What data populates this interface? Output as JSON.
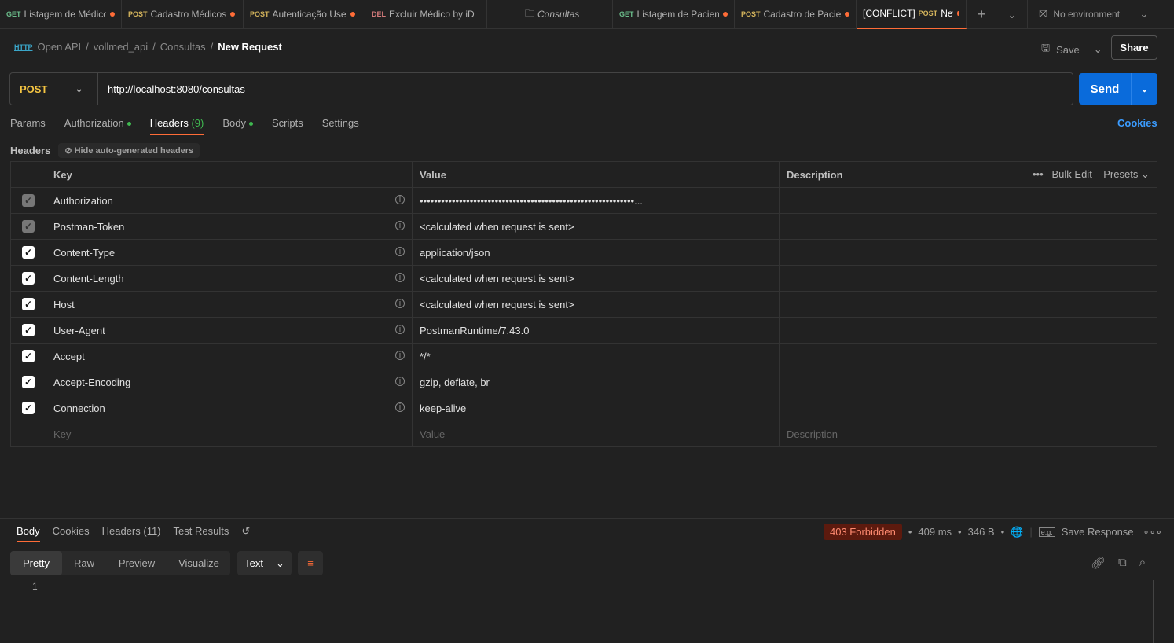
{
  "tabs": [
    {
      "method": "GET",
      "label": "Listagem de Médicc",
      "dirty": true
    },
    {
      "method": "POST",
      "label": "Cadastro Médicos",
      "dirty": true
    },
    {
      "method": "POST",
      "label": "Autenticação Use",
      "dirty": true
    },
    {
      "method": "DEL",
      "label": "Excluir Médico by iD",
      "dirty": false
    },
    {
      "method": "",
      "label": "Consultas",
      "dirty": false
    },
    {
      "method": "GET",
      "label": "Listagem de Pacient",
      "dirty": true
    },
    {
      "method": "POST",
      "label": "Cadastro de Pacier",
      "dirty": true
    },
    {
      "prefix": "[CONFLICT]",
      "method": "POST",
      "label": "New R",
      "dirty": true
    }
  ],
  "environment": "No environment",
  "breadcrumb": [
    "Open API",
    "vollmed_api",
    "Consultas",
    "New Request"
  ],
  "save_label": "Save",
  "share_label": "Share",
  "request": {
    "method": "POST",
    "url": "http://localhost:8080/consultas",
    "send_label": "Send"
  },
  "request_tabs": {
    "params": "Params",
    "authorization": "Authorization",
    "headers": "Headers",
    "headers_count": "(9)",
    "body": "Body",
    "scripts": "Scripts",
    "settings": "Settings",
    "cookies": "Cookies"
  },
  "headers_section": {
    "label": "Headers",
    "hide_auto": "Hide auto-generated headers"
  },
  "table": {
    "columns": [
      "Key",
      "Value",
      "Description"
    ],
    "bulk_edit": "Bulk Edit",
    "presets": "Presets",
    "rows": [
      {
        "key": "Authorization",
        "value": "••••••••••••••••••••••••••••••••••••••••••••••••••••••••••••...",
        "checked": true,
        "disabled": true
      },
      {
        "key": "Postman-Token",
        "value": "<calculated when request is sent>",
        "checked": true,
        "disabled": true
      },
      {
        "key": "Content-Type",
        "value": "application/json",
        "checked": true,
        "disabled": false
      },
      {
        "key": "Content-Length",
        "value": "<calculated when request is sent>",
        "checked": true,
        "disabled": false
      },
      {
        "key": "Host",
        "value": "<calculated when request is sent>",
        "checked": true,
        "disabled": false
      },
      {
        "key": "User-Agent",
        "value": "PostmanRuntime/7.43.0",
        "checked": true,
        "disabled": false
      },
      {
        "key": "Accept",
        "value": "*/*",
        "checked": true,
        "disabled": false
      },
      {
        "key": "Accept-Encoding",
        "value": "gzip, deflate, br",
        "checked": true,
        "disabled": false
      },
      {
        "key": "Connection",
        "value": "keep-alive",
        "checked": true,
        "disabled": false
      }
    ],
    "placeholders": {
      "key": "Key",
      "value": "Value",
      "description": "Description"
    }
  },
  "response": {
    "tabs": [
      "Body",
      "Cookies",
      "Headers (11)",
      "Test Results"
    ],
    "status": "403 Forbidden",
    "time": "409 ms",
    "size": "346 B",
    "save_response": "Save Response",
    "views": [
      "Pretty",
      "Raw",
      "Preview",
      "Visualize"
    ],
    "format": "Text",
    "line": "1"
  },
  "colors": {
    "accent": "#ff6c37",
    "send": "#0a6bdb",
    "error_bg": "#5c1a0e",
    "error_text": "#ff8a70"
  }
}
